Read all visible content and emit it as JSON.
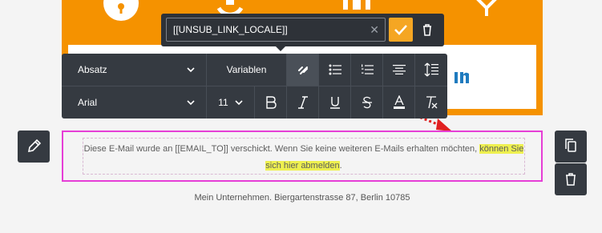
{
  "link_popup": {
    "url_value": "[[UNSUB_LINK_LOCALE]]",
    "clear_icon": "close-icon",
    "confirm_icon": "checkmark-icon",
    "delete_icon": "trash-icon"
  },
  "toolbar": {
    "paragraph_format": "Absatz",
    "variables_label": "Variablen",
    "font_family": "Arial",
    "font_size": "11",
    "icons": [
      "link-icon",
      "unordered-list-icon",
      "ordered-list-icon",
      "align-center-icon",
      "line-height-icon",
      "bold-icon",
      "italic-icon",
      "underline-icon",
      "strikethrough-icon",
      "text-color-icon",
      "clear-format-icon"
    ]
  },
  "text_block": {
    "line1_plain": "Diese E-Mail wurde an [[EMAIL_TO]] verschickt. Wenn Sie keine weiteren E-Mails erhalten möchten,",
    "line1_highlight": "können Sie",
    "line2_highlight": "sich hier abmelden",
    "line2_plain": "."
  },
  "side_buttons": {
    "left": "pencil-icon",
    "right_top": "copy-icon",
    "right_bottom": "trash-icon"
  },
  "footer": {
    "text": "Mein Unternehmen. Biergartenstrasse 87, Berlin 10785"
  },
  "colors": {
    "orange": "#f59200",
    "toolbar_bg": "#353a41",
    "accent": "#f5a623",
    "selection_border": "#e63ed6",
    "highlight": "#eef04f",
    "pointer_arrow": "#e02020"
  }
}
